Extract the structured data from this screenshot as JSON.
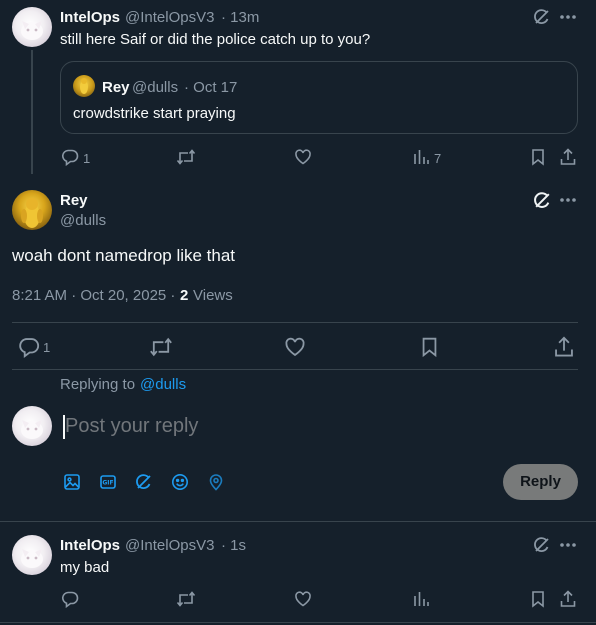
{
  "tweet1": {
    "name": "IntelOps",
    "handle": "@IntelOpsV3",
    "time": "· 13m",
    "text": "still here Saif or did the police catch up to you?",
    "quote": {
      "name": "Rey",
      "handle": "@dulls",
      "time": "· Oct 17",
      "text": "crowdstrike start praying"
    },
    "reply_count": "1",
    "view_count": "7"
  },
  "main_tweet": {
    "name": "Rey",
    "handle": "@dulls",
    "text": "woah dont namedrop like that",
    "timestamp": "8:21 AM · Oct 20, 2025 ·",
    "views_count": "2",
    "views_label": "Views",
    "reply_count": "1"
  },
  "composer": {
    "replying_to_prefix": "Replying to",
    "replying_to_handle": "@dulls",
    "placeholder": "Post your reply",
    "reply_button": "Reply"
  },
  "tweet3": {
    "name": "IntelOps",
    "handle": "@IntelOpsV3",
    "time": "· 1s",
    "text": "my bad"
  },
  "colors": {
    "background": "#15202b",
    "accent": "#1d9bf0",
    "muted": "#8b98a5",
    "divider": "#38444d"
  },
  "icons": [
    "grok-icon",
    "more-icon",
    "reply-icon",
    "retweet-icon",
    "like-icon",
    "views-icon",
    "bookmark-icon",
    "share-icon",
    "image-icon",
    "gif-icon",
    "grok-icon",
    "emoji-icon",
    "location-icon"
  ]
}
